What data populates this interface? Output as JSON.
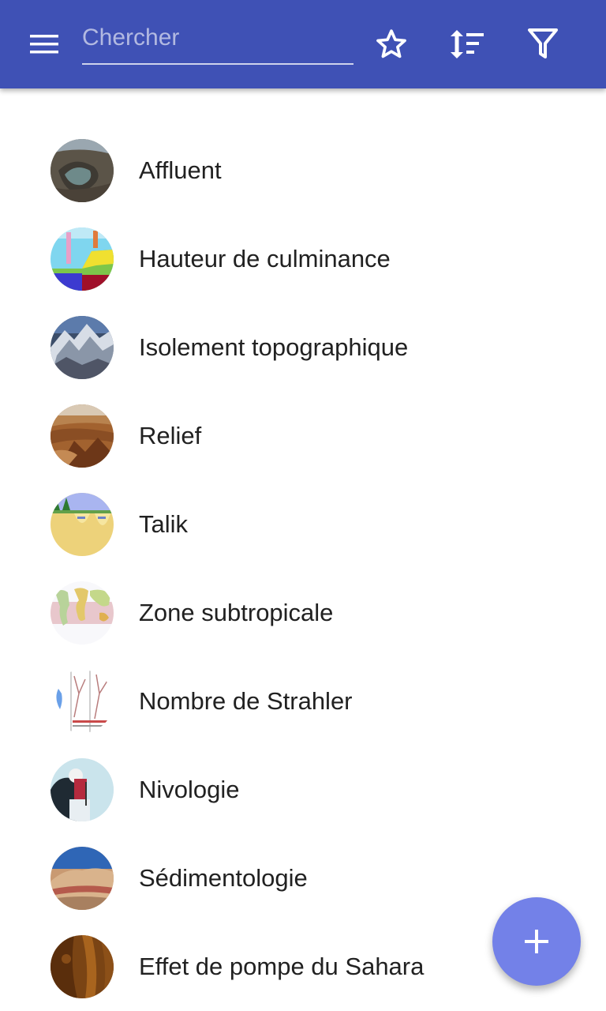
{
  "colors": {
    "appbar": "#3f51b5",
    "fab": "#7381e8",
    "text": "#212121"
  },
  "appbar": {
    "menu_icon": "hamburger-menu-icon",
    "search": {
      "placeholder": "Chercher",
      "value": ""
    },
    "actions": [
      {
        "icon": "star-outline-icon"
      },
      {
        "icon": "sort-icon"
      },
      {
        "icon": "filter-icon"
      }
    ]
  },
  "list": {
    "items": [
      {
        "label": "Affluent",
        "thumbnail": "canyon-river-photo"
      },
      {
        "label": "Hauteur de culminance",
        "thumbnail": "topographic-diagram"
      },
      {
        "label": "Isolement topographique",
        "thumbnail": "snowy-mountains-photo"
      },
      {
        "label": "Relief",
        "thumbnail": "canyon-photo"
      },
      {
        "label": "Talik",
        "thumbnail": "permafrost-diagram"
      },
      {
        "label": "Zone subtropicale",
        "thumbnail": "world-map"
      },
      {
        "label": "Nombre de Strahler",
        "thumbnail": "stream-order-diagram"
      },
      {
        "label": "Nivologie",
        "thumbnail": "snow-researcher-photo"
      },
      {
        "label": "Sédimentologie",
        "thumbnail": "sediment-cliff-photo"
      },
      {
        "label": "Effet de pompe du Sahara",
        "thumbnail": "amber-rock-photo"
      }
    ]
  },
  "fab": {
    "icon": "plus-icon"
  }
}
